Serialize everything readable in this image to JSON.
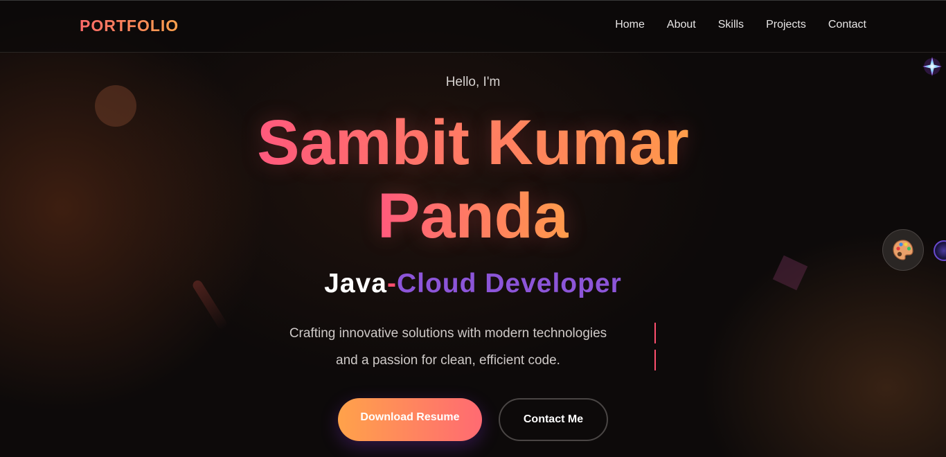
{
  "nav": {
    "logo": "PORTFOLIO",
    "links": [
      "Home",
      "About",
      "Skills",
      "Projects",
      "Contact"
    ]
  },
  "hero": {
    "greeting": "Hello, I'm",
    "name_line1": "Sambit Kumar",
    "name_line2": "Panda",
    "role_part1": "Java",
    "role_dash": "-",
    "role_part2": "Cloud Developer",
    "tagline_line1": "Crafting innovative solutions with modern technologies",
    "tagline_line2": "and a passion for clean, efficient code.",
    "primary_button": "Download Resume",
    "secondary_button": "Contact Me"
  },
  "icons": {
    "theme_toggle": "palette-icon",
    "sparkle": "sparkle-icon"
  },
  "colors": {
    "accent_orange": "#ffa24a",
    "accent_pink": "#ff5a80",
    "accent_purple": "#8c55d8",
    "background": "#0d0a0a"
  }
}
